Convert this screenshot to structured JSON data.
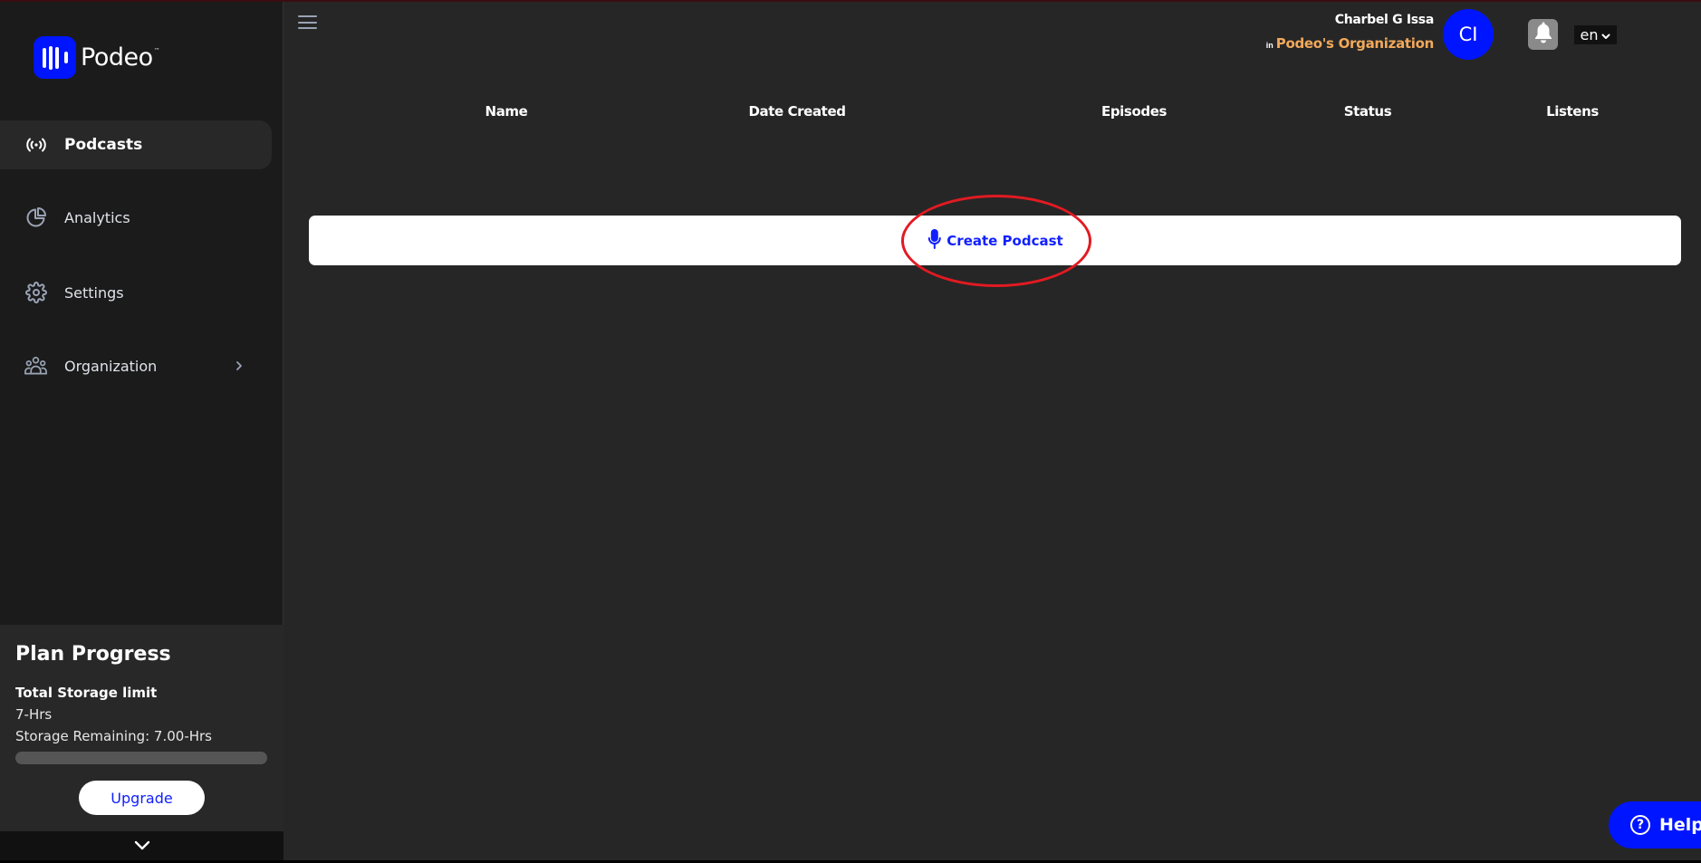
{
  "brand": {
    "name": "Podeo",
    "trademark": "™",
    "accent_color": "#0015ff"
  },
  "sidebar": {
    "items": [
      {
        "label": "Podcasts",
        "icon": "broadcast-icon",
        "active": true
      },
      {
        "label": "Analytics",
        "icon": "pie-chart-icon",
        "active": false
      },
      {
        "label": "Settings",
        "icon": "gear-icon",
        "active": false
      },
      {
        "label": "Organization",
        "icon": "users-icon",
        "active": false,
        "has_submenu": true
      }
    ],
    "plan": {
      "title": "Plan Progress",
      "storage_label": "Total Storage limit",
      "storage_value": "7-Hrs",
      "remaining": "Storage Remaining: 7.00-Hrs",
      "used_fraction": 0.0,
      "upgrade_label": "Upgrade"
    },
    "footer_icon": "chevron-down-icon"
  },
  "header": {
    "menu_icon": "hamburger-icon",
    "user_name": "Charbel G Issa",
    "in_label": "in",
    "organization": "Podeo's Organization",
    "avatar_initials": "CI",
    "notification_icon": "bell-icon",
    "language": "en"
  },
  "table": {
    "columns": [
      "Name",
      "Date Created",
      "Episodes",
      "Status",
      "Listens"
    ],
    "rows": []
  },
  "create": {
    "label": "Create Podcast",
    "icon": "microphone-icon",
    "highlight_color": "#e21a22"
  },
  "help": {
    "label": "Help",
    "icon": "question-circle-icon"
  }
}
